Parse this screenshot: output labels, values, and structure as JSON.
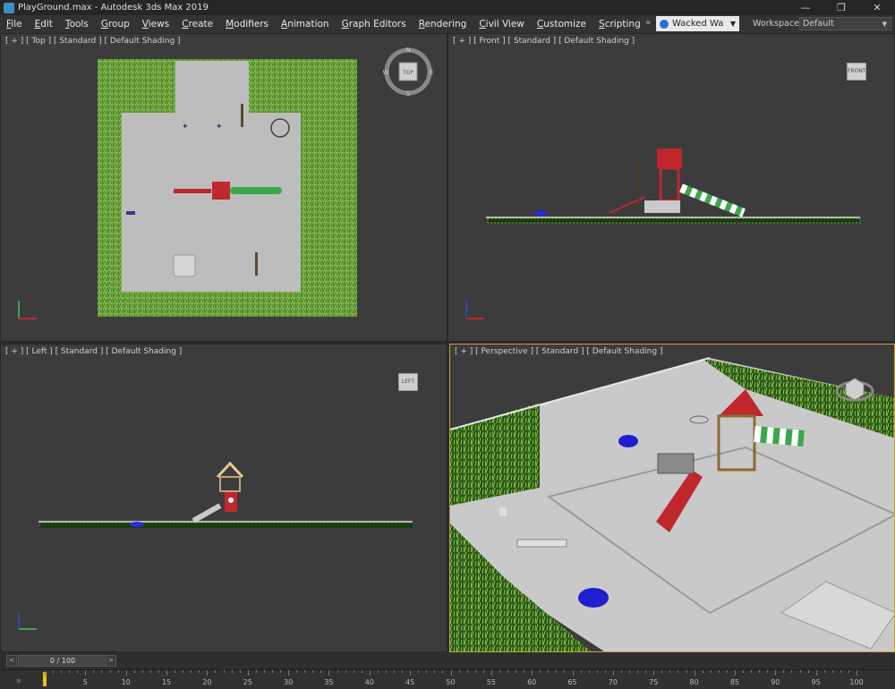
{
  "title_bar": {
    "title": "PlayGround.max - Autodesk 3ds Max 2019",
    "minimize": "—",
    "maximize": "❐",
    "close": "✕"
  },
  "menu": [
    "File",
    "Edit",
    "Tools",
    "Group",
    "Views",
    "Create",
    "Modifiers",
    "Animation",
    "Graph Editors",
    "Rendering",
    "Civil View",
    "Customize",
    "Scripting"
  ],
  "user": {
    "name": "Wacked Wa"
  },
  "workspace": {
    "label": "Workspaces:",
    "value": "Default"
  },
  "viewports": {
    "top": {
      "label": "[ + ] [ Top ] [ Standard ] [ Default Shading ]",
      "cube": "TOP",
      "compass": {
        "n": "N",
        "s": "S",
        "e": "E",
        "w": "W"
      }
    },
    "front": {
      "label": "[ + ] [ Front ] [ Standard ] [ Default Shading ]",
      "cube": "FRONT"
    },
    "left": {
      "label": "[ + ] [ Left ] [ Standard ] [ Default Shading ]",
      "cube": "LEFT"
    },
    "perspective": {
      "label": "[ + ] [ Perspective ] [ Standard ] [ Default Shading ]"
    }
  },
  "timeline": {
    "frame": "0 / 100",
    "prev": "<",
    "next": ">",
    "ticks": [
      "5",
      "10",
      "15",
      "20",
      "25",
      "30",
      "35",
      "40",
      "45",
      "50",
      "55",
      "60",
      "65",
      "70",
      "75",
      "80",
      "85",
      "90",
      "95",
      "100"
    ]
  },
  "colors": {
    "grass": "#7fb84a",
    "ground": "#bdbdbd",
    "red": "#c0272d",
    "slide_green": "#3aa84a",
    "viewport_bg": "#3c3c3c",
    "active_border": "#c8a03a"
  }
}
